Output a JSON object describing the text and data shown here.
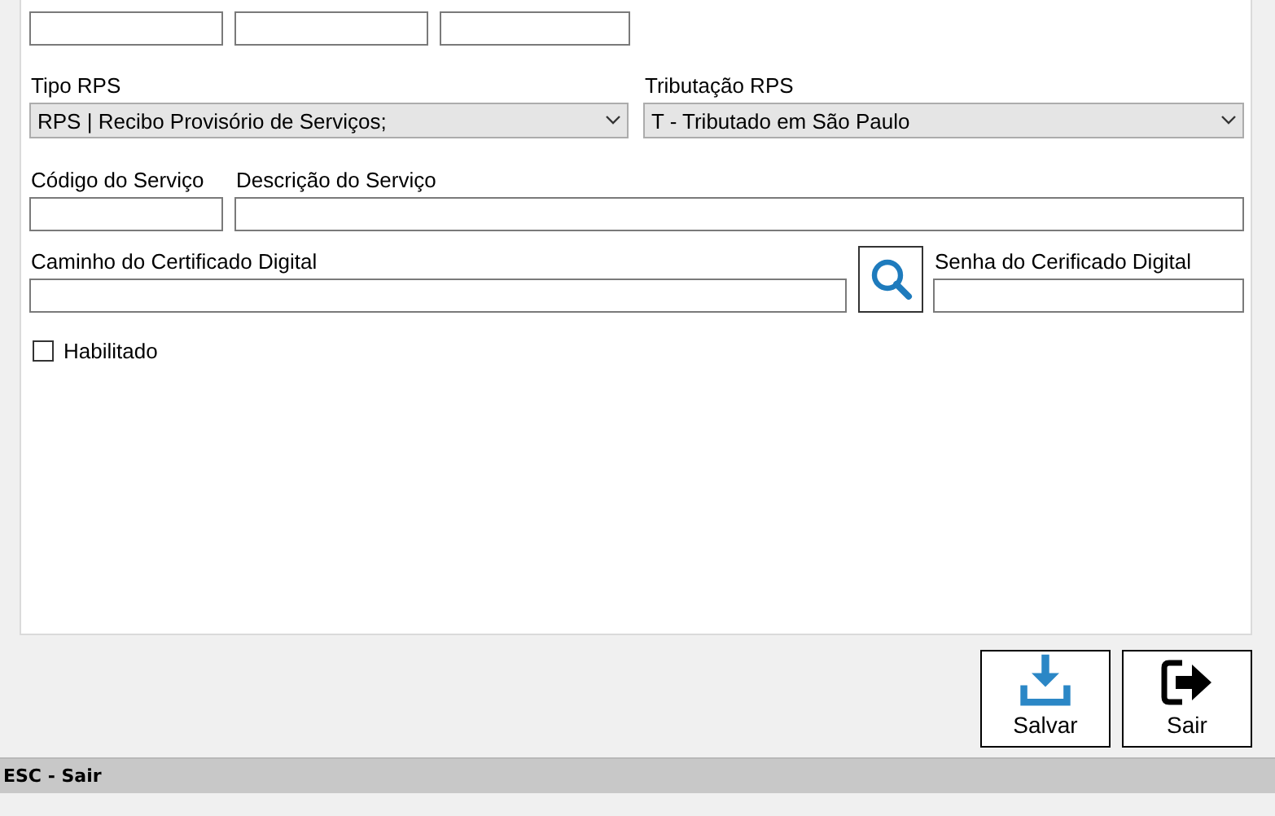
{
  "form": {
    "rows": [
      {
        "fields": [
          {
            "kind": "dropdown",
            "label": "Tipo RPS",
            "value": "RPS | Recibo Provisório de Serviços;"
          },
          {
            "kind": "dropdown",
            "label": "Tributação RPS",
            "value": "T - Tributado em São Paulo"
          }
        ]
      },
      {
        "fields": [
          {
            "kind": "text",
            "label": "Código do Serviço"
          },
          {
            "kind": "text",
            "label": "Descrição do Serviço"
          }
        ]
      },
      {
        "fields": [
          {
            "kind": "text",
            "label": "Caminho do Certificado Digital"
          },
          {
            "kind": "browse"
          },
          {
            "kind": "text",
            "label": "Senha do Cerificado Digital"
          }
        ]
      }
    ],
    "checkbox": {
      "label": "Habilitado",
      "checked": false
    }
  },
  "buttons": [
    {
      "kind": "save",
      "label": "Salvar"
    },
    {
      "kind": "exit",
      "label": "Sair"
    }
  ],
  "status_bar": {
    "text": "ESC - Sair"
  }
}
